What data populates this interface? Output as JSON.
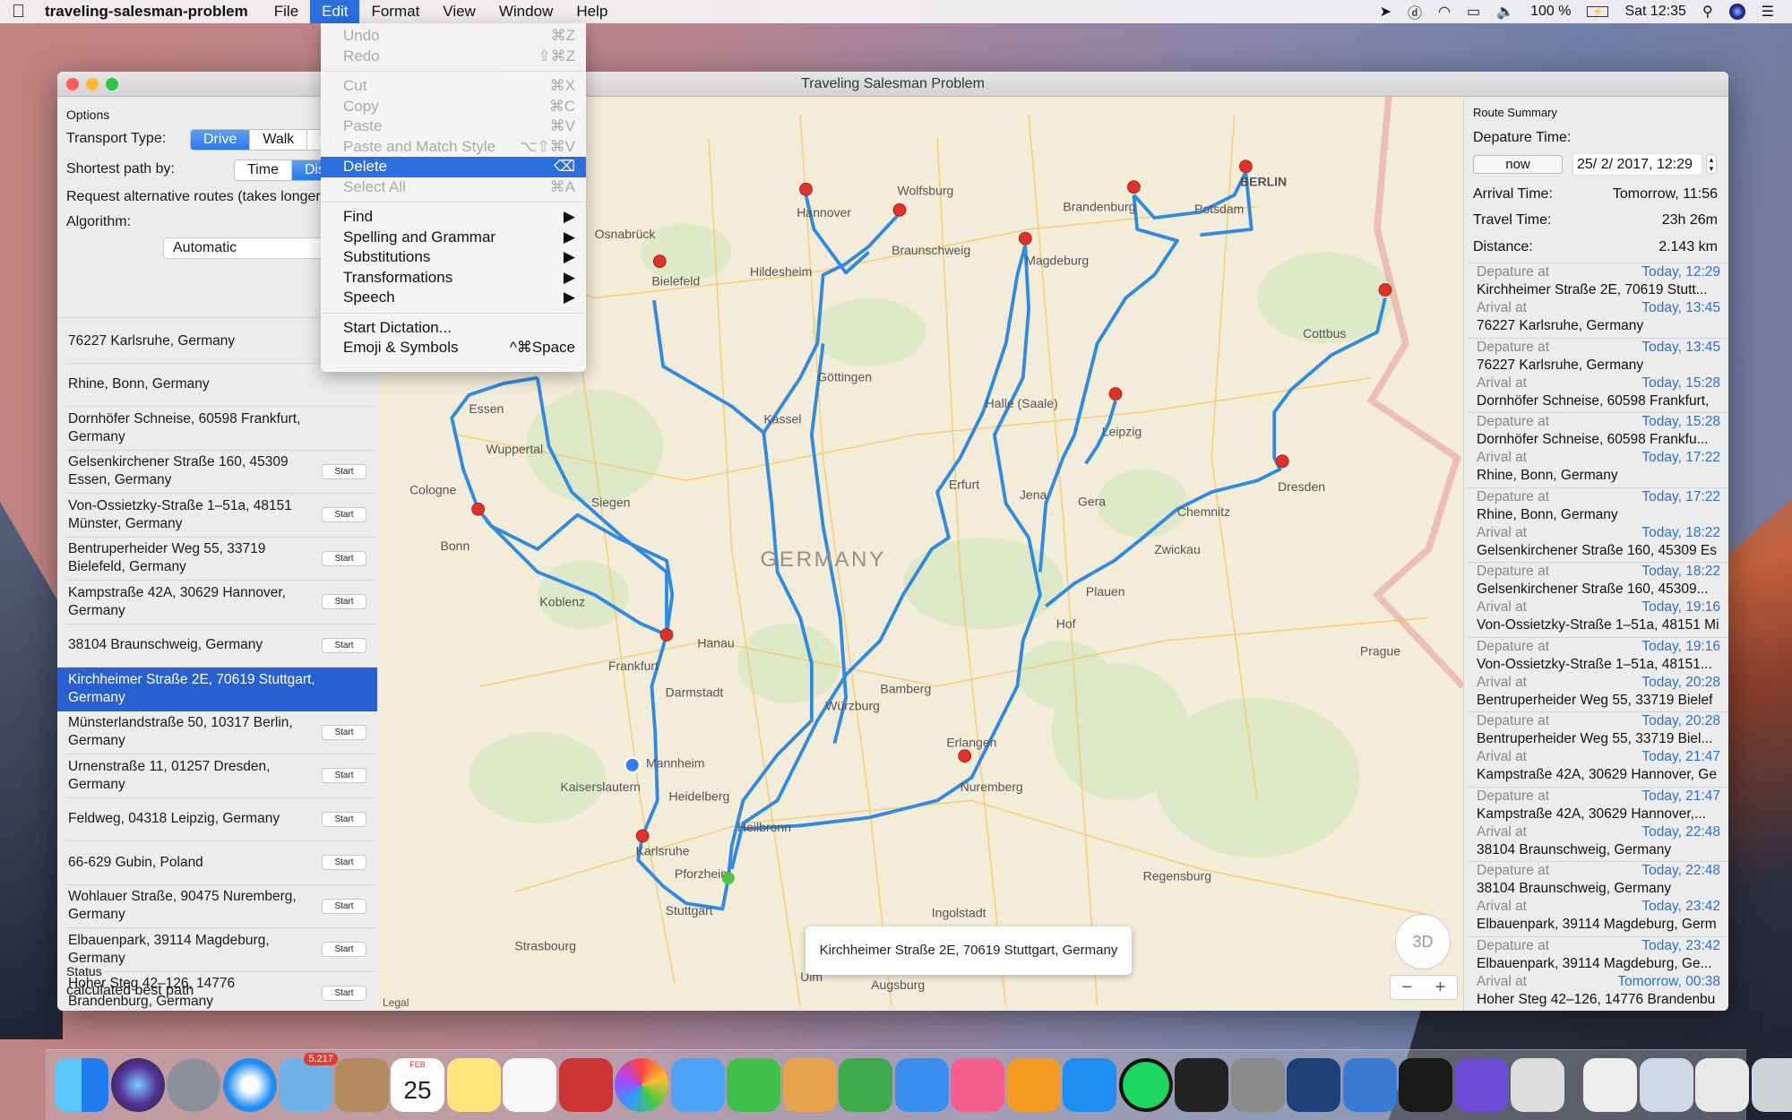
{
  "menubar": {
    "app": "traveling-salesman-problem",
    "items": [
      "File",
      "Edit",
      "Format",
      "View",
      "Window",
      "Help"
    ],
    "active": "Edit",
    "battery": "100 %",
    "clock": "Sat 12:35",
    "status_icons": [
      "location-arrow-icon",
      "dashlane-icon",
      "wifi-icon",
      "airplay-icon",
      "volume-icon",
      "battery-charging-icon",
      "spotlight-search-icon",
      "siri-icon",
      "notification-center-icon"
    ]
  },
  "edit_menu": {
    "groups": [
      [
        {
          "label": "Undo",
          "shortcut": "⌘Z",
          "enabled": false
        },
        {
          "label": "Redo",
          "shortcut": "⇧⌘Z",
          "enabled": false
        }
      ],
      [
        {
          "label": "Cut",
          "shortcut": "⌘X",
          "enabled": false
        },
        {
          "label": "Copy",
          "shortcut": "⌘C",
          "enabled": false
        },
        {
          "label": "Paste",
          "shortcut": "⌘V",
          "enabled": false
        },
        {
          "label": "Paste and Match Style",
          "shortcut": "⌥⇧⌘V",
          "enabled": false
        },
        {
          "label": "Delete",
          "shortcut": "⌫",
          "enabled": true,
          "highlighted": true
        },
        {
          "label": "Select All",
          "shortcut": "⌘A",
          "enabled": false
        }
      ],
      [
        {
          "label": "Find",
          "shortcut": "▶",
          "enabled": true
        },
        {
          "label": "Spelling and Grammar",
          "shortcut": "▶",
          "enabled": true
        },
        {
          "label": "Substitutions",
          "shortcut": "▶",
          "enabled": true
        },
        {
          "label": "Transformations",
          "shortcut": "▶",
          "enabled": true
        },
        {
          "label": "Speech",
          "shortcut": "▶",
          "enabled": true
        }
      ],
      [
        {
          "label": "Start Dictation...",
          "shortcut": "",
          "enabled": true
        },
        {
          "label": "Emoji & Symbols",
          "shortcut": "^⌘Space",
          "enabled": true
        }
      ]
    ]
  },
  "window": {
    "title": "Traveling Salesman Problem"
  },
  "options": {
    "heading": "Options",
    "transport_label": "Transport Type:",
    "transport_options": [
      "Drive",
      "Walk",
      "Tr"
    ],
    "transport_selected": "Drive",
    "shortest_label": "Shortest path by:",
    "shortest_options": [
      "Time",
      "Dis"
    ],
    "shortest_selected": "Dis",
    "alternative_label": "Request alternative routes (takes longer)",
    "algorithm_label": "Algorithm:",
    "algorithm_value": "Automatic"
  },
  "locations": [
    {
      "address": "76227 Karlsruhe, Germany",
      "button": ""
    },
    {
      "address": "Rhine, Bonn, Germany",
      "button": ""
    },
    {
      "address": "Dornhöfer Schneise, 60598 Frankfurt, Germany",
      "button": ""
    },
    {
      "address": "Gelsenkirchener Straße 160, 45309 Essen, Germany",
      "button": "Start"
    },
    {
      "address": "Von-Ossietzky-Straße 1–51a, 48151 Münster, Germany",
      "button": "Start"
    },
    {
      "address": "Bentruperheider Weg 55, 33719 Bielefeld, Germany",
      "button": "Start"
    },
    {
      "address": "Kampstraße 42A, 30629 Hannover, Germany",
      "button": "Start"
    },
    {
      "address": "38104 Braunschweig, Germany",
      "button": "Start"
    },
    {
      "address": "Kirchheimer Straße 2E, 70619 Stuttgart, Germany",
      "button": "",
      "selected": true
    },
    {
      "address": "Münsterlandstraße 50, 10317 Berlin, Germany",
      "button": "Start"
    },
    {
      "address": "Urnenstraße 11, 01257 Dresden, Germany",
      "button": "Start"
    },
    {
      "address": "Feldweg, 04318 Leipzig, Germany",
      "button": "Start"
    },
    {
      "address": "66-629 Gubin, Poland",
      "button": "Start"
    },
    {
      "address": "Wohlauer Straße, 90475 Nuremberg, Germany",
      "button": "Start"
    },
    {
      "address": "Elbauenpark, 39114 Magdeburg, Germany",
      "button": "Start"
    },
    {
      "address": "Hoher Steg 42–126, 14776 Brandenburg, Germany",
      "button": "Start"
    }
  ],
  "status": {
    "label": "Status",
    "value": "calculated best path"
  },
  "map": {
    "tooltip": "Kirchheimer Straße 2E, 70619 Stuttgart, Germany",
    "btn_3d": "3D",
    "zoom_out": "−",
    "zoom_in": "+",
    "legal": "Legal",
    "route_color": "#2f8ae6",
    "pin_color": "#e0302a",
    "labels": [
      "GERMANY",
      "BERLIN",
      "Hannover",
      "Braunschweig",
      "Wolfsburg",
      "Magdeburg",
      "Bielefeld",
      "Osnabrück",
      "Potsdam",
      "Brandenburg",
      "Leipzig",
      "Dresden",
      "Halle (Saale)",
      "Kassel",
      "Erfurt",
      "Jena",
      "Chemnitz",
      "Essen",
      "Wuppertal",
      "Cologne",
      "Bonn",
      "Siegen",
      "Koblenz",
      "Frankfurt",
      "Hanau",
      "Darmstadt",
      "Mannheim",
      "Heidelberg",
      "Karlsruhe",
      "Stuttgart",
      "Würzburg",
      "Bamberg",
      "Nuremberg",
      "Erlangen",
      "Ingolstadt",
      "Augsburg",
      "Prague",
      "Strasbourg",
      "Pforzheim",
      "Göttingen",
      "Hildesheim",
      "Gera",
      "Zwickau",
      "Plauen",
      "Hof",
      "Kaiserslautern",
      "Heilbronn",
      "Ulm",
      "Regensburg",
      "Cottbus"
    ]
  },
  "summary": {
    "heading": "Route Summary",
    "departure_label": "Depature Time:",
    "now_button": "now",
    "departure_value": "25/  2/ 2017,  12:29",
    "arrival_label": "Arrival Time:",
    "arrival_value": "Tomorrow, 11:56",
    "travel_label": "Travel Time:",
    "travel_value": "23h 26m",
    "distance_label": "Distance:",
    "distance_value": "2.143 km",
    "dep_word": "Depature at",
    "arr_word": "Arival at",
    "segments": [
      {
        "dep_time": "Today, 12:29",
        "dep_place": "Kirchheimer Straße 2E, 70619 Stutt...",
        "arr_time": "Today, 13:45",
        "arr_place": "76227 Karlsruhe, Germany"
      },
      {
        "dep_time": "Today, 13:45",
        "dep_place": "76227 Karlsruhe, Germany",
        "arr_time": "Today, 15:28",
        "arr_place": "Dornhöfer Schneise, 60598 Frankfurt,"
      },
      {
        "dep_time": "Today, 15:28",
        "dep_place": "Dornhöfer Schneise, 60598 Frankfu...",
        "arr_time": "Today, 17:22",
        "arr_place": "Rhine, Bonn, Germany"
      },
      {
        "dep_time": "Today, 17:22",
        "dep_place": "Rhine, Bonn, Germany",
        "arr_time": "Today, 18:22",
        "arr_place": "Gelsenkirchener Straße 160, 45309 Es"
      },
      {
        "dep_time": "Today, 18:22",
        "dep_place": "Gelsenkirchener Straße 160, 45309...",
        "arr_time": "Today, 19:16",
        "arr_place": "Von-Ossietzky-Straße 1–51a, 48151 Mi"
      },
      {
        "dep_time": "Today, 19:16",
        "dep_place": "Von-Ossietzky-Straße 1–51a, 48151...",
        "arr_time": "Today, 20:28",
        "arr_place": "Bentruperheider Weg 55, 33719 Bielef"
      },
      {
        "dep_time": "Today, 20:28",
        "dep_place": "Bentruperheider Weg 55, 33719 Biel...",
        "arr_time": "Today, 21:47",
        "arr_place": "Kampstraße 42A, 30629 Hannover, Ge"
      },
      {
        "dep_time": "Today, 21:47",
        "dep_place": "Kampstraße 42A, 30629 Hannover,...",
        "arr_time": "Today, 22:48",
        "arr_place": "38104 Braunschweig, Germany"
      },
      {
        "dep_time": "Today, 22:48",
        "dep_place": "38104 Braunschweig, Germany",
        "arr_time": "Today, 23:42",
        "arr_place": "Elbauenpark, 39114 Magdeburg, Germ"
      },
      {
        "dep_time": "Today, 23:42",
        "dep_place": "Elbauenpark, 39114 Magdeburg, Ge...",
        "arr_time": "Tomorrow, 00:38",
        "arr_place": "Hoher Steg 42–126, 14776 Brandenbu"
      }
    ]
  },
  "dock": {
    "mail_badge": "5.217",
    "calendar_month": "FEB",
    "calendar_day": "25",
    "apps": [
      "finder",
      "siri",
      "launchpad",
      "safari",
      "mail",
      "contacts",
      "calendar",
      "notes",
      "reminders",
      "photo-booth",
      "photos",
      "messages",
      "facetime",
      "keynote-preview",
      "numbers",
      "keynote",
      "itunes",
      "ibooks",
      "app-store",
      "spotify",
      "activity-monitor",
      "system-preferences",
      "sourcetree",
      "xcode",
      "terminal",
      "imovie",
      "preview",
      "documents",
      "downloads",
      "finder-window",
      "trash"
    ]
  }
}
